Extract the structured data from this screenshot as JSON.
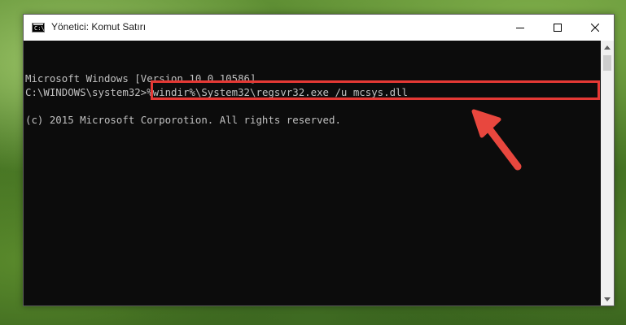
{
  "window": {
    "title": "Yönetici: Komut Satırı",
    "icon": "cmd-icon",
    "icon_glyph": "C:\\"
  },
  "controls": {
    "minimize": "minimize-icon",
    "maximize": "maximize-icon",
    "close": "close-icon"
  },
  "console": {
    "lines": [
      "Microsoft Windows [Version 10.0.10586]",
      "(c) 2015 Microsoft Corporotion. All rights reserved."
    ],
    "prompt": "C:\\WINDOWS\\system32>",
    "command": "%windir%\\System32\\regsvr32.exe /u mcsys.dll"
  },
  "annotation": {
    "highlight_color": "#e53935",
    "arrow_color": "#e8473e"
  }
}
